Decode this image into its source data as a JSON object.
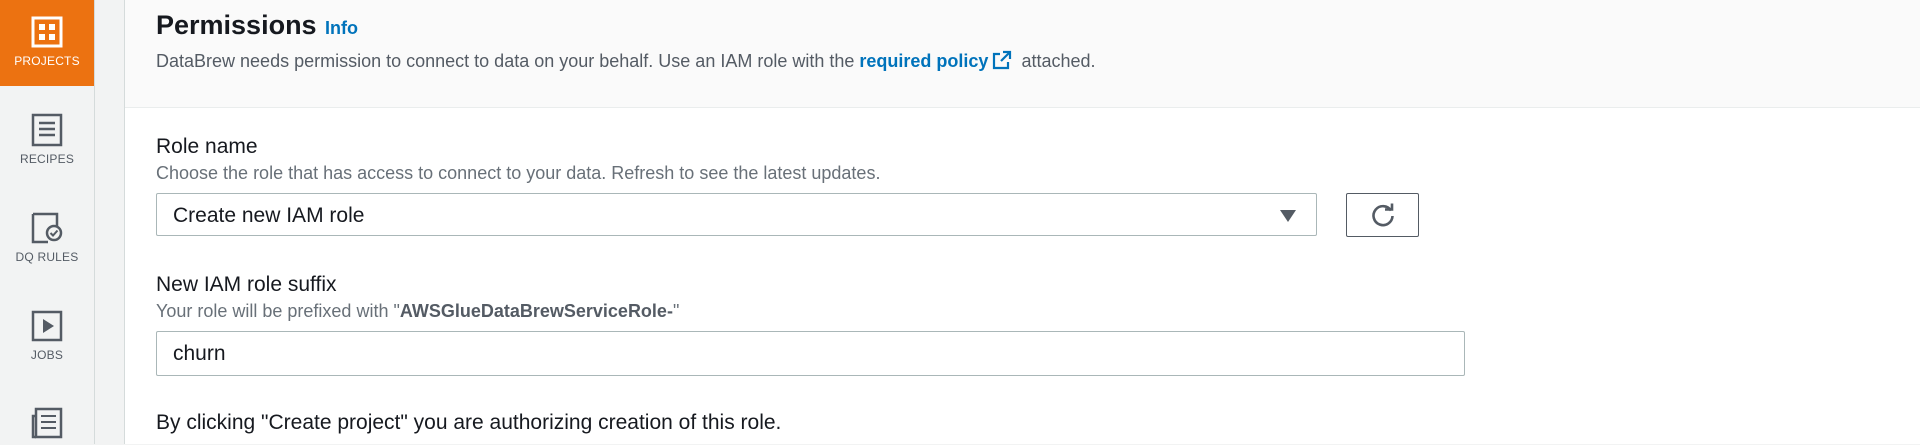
{
  "sidebar": {
    "items": [
      {
        "label": "PROJECTS",
        "icon": "projects-icon",
        "active": true
      },
      {
        "label": "RECIPES",
        "icon": "recipes-icon",
        "active": false
      },
      {
        "label": "DQ RULES",
        "icon": "dq-rules-icon",
        "active": false
      },
      {
        "label": "JOBS",
        "icon": "jobs-icon",
        "active": false
      },
      {
        "label": "",
        "icon": "datasets-icon",
        "active": false
      }
    ]
  },
  "header": {
    "title": "Permissions",
    "info_link": "Info",
    "description_prefix": "DataBrew needs permission to connect to data on your behalf. Use an IAM role with the",
    "description_link": "required policy",
    "description_suffix": "attached."
  },
  "role_name": {
    "label": "Role name",
    "hint": "Choose the role that has access to connect to your data. Refresh to see the latest updates.",
    "selected_value": "Create new IAM role"
  },
  "role_suffix": {
    "label": "New IAM role suffix",
    "hint_prefix": "Your role will be prefixed with \"",
    "hint_bold": "AWSGlueDataBrewServiceRole-",
    "hint_suffix": "\"",
    "value": "churn"
  },
  "notice": "By clicking \"Create project\" you are authorizing creation of this role.",
  "colors": {
    "accent": "#ec7211",
    "link": "#0073bb",
    "text": "#16191f",
    "muted": "#687078"
  }
}
